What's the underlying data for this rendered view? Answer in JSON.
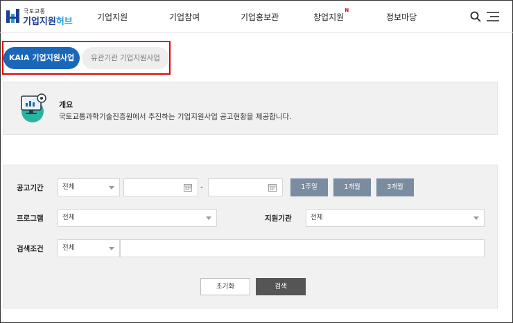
{
  "header": {
    "logo_small": "국토교통",
    "logo_main": "기업지원",
    "logo_hub": "허브",
    "nav": [
      {
        "label": "기업지원"
      },
      {
        "label": "기업참여"
      },
      {
        "label": "기업홍보관"
      },
      {
        "label": "창업지원",
        "badge": "N"
      },
      {
        "label": "정보마당"
      }
    ]
  },
  "tabs": {
    "active": "KAIA 기업지원사업",
    "inactive": "유관기관 기업지원사업"
  },
  "overview": {
    "title": "개요",
    "description": "국토교통과학기술진흥원에서 추진하는 기업지원사업 공고현황을 제공합니다."
  },
  "search": {
    "period_label": "공고기간",
    "period_select": "전체",
    "date_separator": "-",
    "period_buttons": [
      "1주일",
      "1개월",
      "3개월"
    ],
    "program_label": "프로그램",
    "program_select": "전체",
    "agency_label": "지원기관",
    "agency_select": "전체",
    "condition_label": "검색조건",
    "condition_select": "전체",
    "reset_label": "초기화",
    "search_label": "검색"
  },
  "colors": {
    "brand_blue": "#1a66b8",
    "highlight_red": "#e00000",
    "period_button": "#7a8ca0",
    "search_button": "#555555"
  }
}
